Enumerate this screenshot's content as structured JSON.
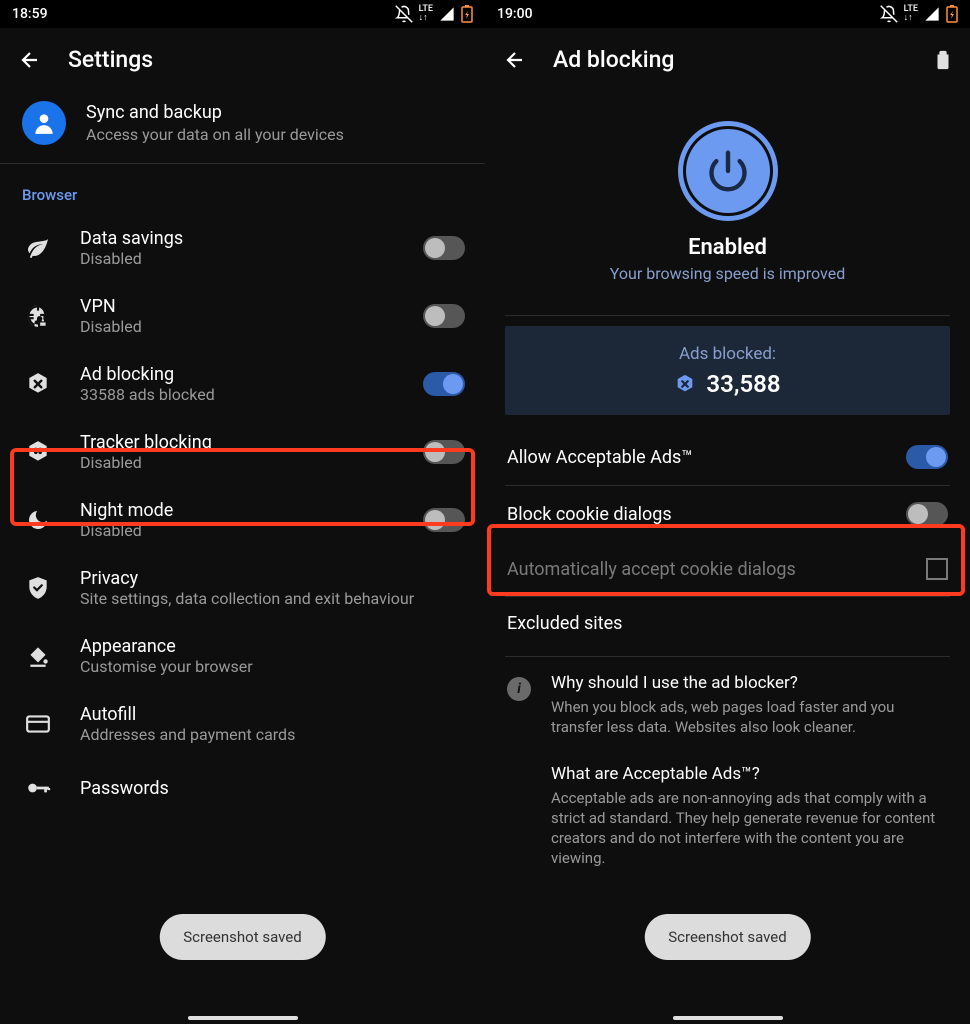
{
  "left": {
    "status_time": "18:59",
    "header_title": "Settings",
    "sync": {
      "title": "Sync and backup",
      "subtitle": "Access your data on all your devices"
    },
    "section_browser": "Browser",
    "rows": {
      "data_savings": {
        "title": "Data savings",
        "subtitle": "Disabled"
      },
      "vpn": {
        "title": "VPN",
        "subtitle": "Disabled"
      },
      "ad_blocking": {
        "title": "Ad blocking",
        "subtitle": "33588 ads blocked"
      },
      "tracker_blocking": {
        "title": "Tracker blocking",
        "subtitle": "Disabled"
      },
      "night_mode": {
        "title": "Night mode",
        "subtitle": "Disabled"
      },
      "privacy": {
        "title": "Privacy",
        "subtitle": "Site settings, data collection and exit behaviour"
      },
      "appearance": {
        "title": "Appearance",
        "subtitle": "Customise your browser"
      },
      "autofill": {
        "title": "Autofill",
        "subtitle": "Addresses and payment cards"
      },
      "passwords": {
        "title": "Passwords"
      }
    },
    "toast": "Screenshot saved"
  },
  "right": {
    "status_time": "19:00",
    "header_title": "Ad blocking",
    "enabled_title": "Enabled",
    "enabled_subtitle": "Your browsing speed is improved",
    "ads_blocked_label": "Ads blocked:",
    "ads_blocked_count": "33,588",
    "rows": {
      "acceptable": "Allow Acceptable Ads™",
      "block_cookie": "Block cookie dialogs",
      "auto_accept": "Automatically accept cookie dialogs",
      "excluded": "Excluded sites"
    },
    "info": {
      "q1": "Why should I use the ad blocker?",
      "a1": "When you block ads, web pages load faster and you transfer less data. Websites also look cleaner.",
      "q2": "What are Acceptable Ads™?",
      "a2": "Acceptable ads are non-annoying ads that comply with a strict ad standard. They help generate revenue for content creators and do not interfere with the content you are viewing."
    },
    "toast": "Screenshot saved"
  }
}
